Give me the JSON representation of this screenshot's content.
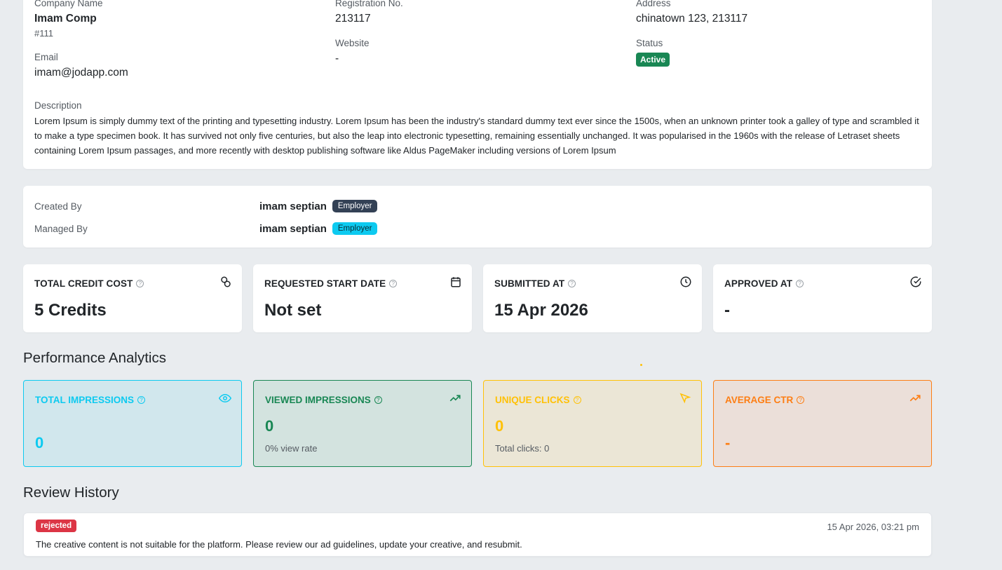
{
  "company": {
    "name_label": "Company Name",
    "name": "Imam Comp",
    "id": "#111",
    "email_label": "Email",
    "email": "imam@jodapp.com",
    "reg_label": "Registration No.",
    "reg": "213117",
    "website_label": "Website",
    "website": "-",
    "address_label": "Address",
    "address": "chinatown 123, 213117",
    "status_label": "Status",
    "status": "Active",
    "description_label": "Description",
    "description": "Lorem Ipsum is simply dummy text of the printing and typesetting industry. Lorem Ipsum has been the industry's standard dummy text ever since the 1500s, when an unknown printer took a galley of type and scrambled it to make a type specimen book. It has survived not only five centuries, but also the leap into electronic typesetting, remaining essentially unchanged. It was popularised in the 1960s with the release of Letraset sheets containing Lorem Ipsum passages, and more recently with desktop publishing software like Aldus PageMaker including versions of Lorem Ipsum"
  },
  "people": {
    "created_label": "Created By",
    "created_name": "imam septian",
    "created_role": "Employer",
    "managed_label": "Managed By",
    "managed_name": "imam septian",
    "managed_role": "Employer"
  },
  "stats": [
    {
      "title": "TOTAL CREDIT COST",
      "value": "5 Credits",
      "icon": "coins-icon"
    },
    {
      "title": "REQUESTED START DATE",
      "value": "Not set",
      "icon": "calendar-icon"
    },
    {
      "title": "SUBMITTED AT",
      "value": "15 Apr 2026",
      "icon": "clock-icon"
    },
    {
      "title": "APPROVED AT",
      "value": "-",
      "icon": "check-circle-icon"
    }
  ],
  "analytics": {
    "heading": "Performance Analytics",
    "total_impressions": {
      "title": "TOTAL IMPRESSIONS",
      "value": "0",
      "icon": "eye-icon",
      "color": "#0dcaf0"
    },
    "viewed_impressions": {
      "title": "VIEWED IMPRESSIONS",
      "value": "0",
      "sub": "0% view rate",
      "icon": "trending-up-icon",
      "color": "#198754"
    },
    "unique_clicks": {
      "title": "UNIQUE CLICKS",
      "value": "0",
      "sub": "Total clicks: 0",
      "icon": "cursor-icon",
      "color": "#ffc107"
    },
    "average_ctr": {
      "title": "AVERAGE CTR",
      "value": "-",
      "icon": "trending-up-icon",
      "color": "#fd7e14"
    }
  },
  "review": {
    "heading": "Review History",
    "status": "rejected",
    "date": "15 Apr 2026, 03:21 pm",
    "message": "The creative content is not suitable for the platform. Please review our ad guidelines, update your creative, and resubmit."
  }
}
